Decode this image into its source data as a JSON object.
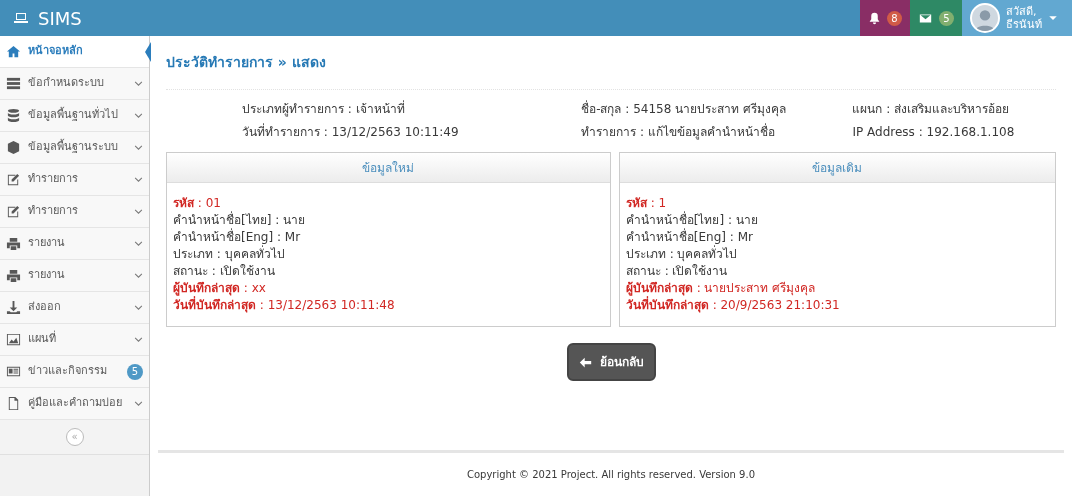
{
  "brand": {
    "title": "SIMS"
  },
  "topbar": {
    "notifications": {
      "count": "8"
    },
    "messages": {
      "count": "5"
    },
    "user": {
      "greeting": "สวัสดี,",
      "name": "ธีรนันท์"
    }
  },
  "sidebar": {
    "items": [
      {
        "kind": "home",
        "label": "หน้าจอหลัก",
        "selected": true,
        "caret": false
      },
      {
        "kind": "server",
        "label": "ข้อกำหนดระบบ",
        "selected": false,
        "caret": true
      },
      {
        "kind": "database",
        "label": "ข้อมูลพื้นฐานทั่วไป",
        "selected": false,
        "caret": true
      },
      {
        "kind": "cube",
        "label": "ข้อมูลพื้นฐานระบบ",
        "selected": false,
        "caret": true
      },
      {
        "kind": "edit",
        "label": "ทำรายการ",
        "selected": false,
        "caret": true
      },
      {
        "kind": "edit",
        "label": "ทำรายการ",
        "selected": false,
        "caret": true
      },
      {
        "kind": "print",
        "label": "รายงาน",
        "selected": false,
        "caret": true
      },
      {
        "kind": "print",
        "label": "รายงาน",
        "selected": false,
        "caret": true
      },
      {
        "kind": "download",
        "label": "ส่งออก",
        "selected": false,
        "caret": true
      },
      {
        "kind": "image",
        "label": "แผนที่",
        "selected": false,
        "caret": true
      },
      {
        "kind": "news",
        "label": "ข่าวและกิจกรรม",
        "selected": false,
        "caret": false,
        "badge": "5"
      },
      {
        "kind": "file",
        "label": "คู่มือและคำถามบ่อย",
        "selected": false,
        "caret": true
      }
    ],
    "collapse": "«"
  },
  "page": {
    "title": "ประวัติทำรายการ » แสดง",
    "info": [
      "ประเภทผู้ทำรายการ : เจ้าหน้าที่",
      "ชื่อ-สกุล : 54158  นายประสาท ศรีมุงคุล",
      "แผนก : ส่งเสริมและบริหารอ้อย",
      "วันที่ทำรายการ : 13/12/2563 10:11:49",
      "ทำรายการ : แก้ไขข้อมูลคำนำหน้าชื่อ",
      "IP Address : 192.168.1.108"
    ],
    "panels": [
      {
        "title": "ข้อมูลใหม่",
        "lines": [
          {
            "text": "**รหัส** : 01",
            "highlight": true
          },
          {
            "text": "คำนำหน้าชื่อ[ไทย] : นาย",
            "highlight": false
          },
          {
            "text": "คำนำหน้าชื่อ[Eng] : Mr",
            "highlight": false
          },
          {
            "text": "ประเภท : บุคคลทั่วไป",
            "highlight": false
          },
          {
            "text": "สถานะ : เปิดใช้งาน",
            "highlight": false
          },
          {
            "text": "**ผู้บันทึกล่าสุด** : xx",
            "highlight": true
          },
          {
            "text": "**วันที่บันทึกล่าสุด** : 13/12/2563 10:11:48",
            "highlight": true
          }
        ]
      },
      {
        "title": "ข้อมูลเดิม",
        "lines": [
          {
            "text": "**รหัส** : 1",
            "highlight": true
          },
          {
            "text": "คำนำหน้าชื่อ[ไทย] : นาย",
            "highlight": false
          },
          {
            "text": "คำนำหน้าชื่อ[Eng] : Mr",
            "highlight": false
          },
          {
            "text": "ประเภท : บุคคลทั่วไป",
            "highlight": false
          },
          {
            "text": "สถานะ : เปิดใช้งาน",
            "highlight": false
          },
          {
            "text": "**ผู้บันทึกล่าสุด** : นายประสาท ศรีมุงคุล",
            "highlight": true
          },
          {
            "text": "**วันที่บันทึกล่าสุด** : 20/9/2563 21:10:31",
            "highlight": true
          }
        ]
      }
    ],
    "back_button": "ย้อนกลับ"
  },
  "footer": "Copyright © 2021 Project. All rights reserved. Version 9.0"
}
